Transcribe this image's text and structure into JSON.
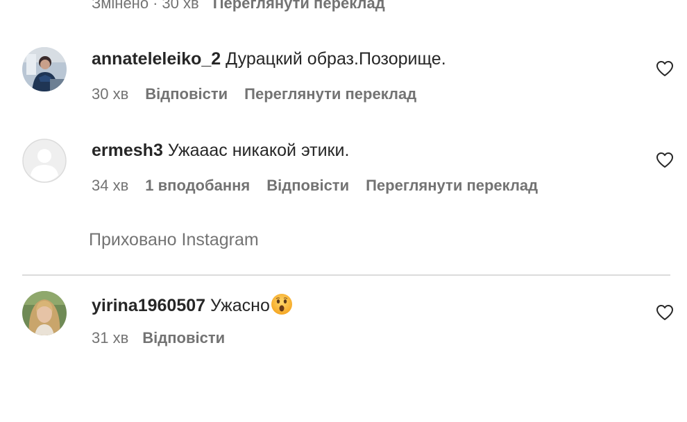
{
  "top_partial": {
    "edited_label": "Змінено",
    "separator": "·",
    "time": "30 хв",
    "translate_label": "Переглянути переклад"
  },
  "comments": [
    {
      "username": "annateleleiko_2",
      "text": "Дурацкий образ.Позорище.",
      "time": "30 хв",
      "reply_label": "Відповісти",
      "translate_label": "Переглянути переклад"
    },
    {
      "username": "ermesh3",
      "text": "Ужааас никакой этики.",
      "time": "34 хв",
      "likes_label": "1 вподобання",
      "reply_label": "Відповісти",
      "translate_label": "Переглянути переклад"
    },
    {
      "username": "yirina1960507",
      "text": "Ужасно",
      "emoji_icon": "astonished-face-emoji",
      "time": "31 хв",
      "reply_label": "Відповісти"
    }
  ],
  "hidden_notice": "Приховано Instagram",
  "colors": {
    "text_primary": "#262626",
    "text_secondary": "#737373",
    "divider": "#dbdbdb"
  },
  "icons": [
    "heart-outline-icon",
    "default-avatar-icon"
  ]
}
